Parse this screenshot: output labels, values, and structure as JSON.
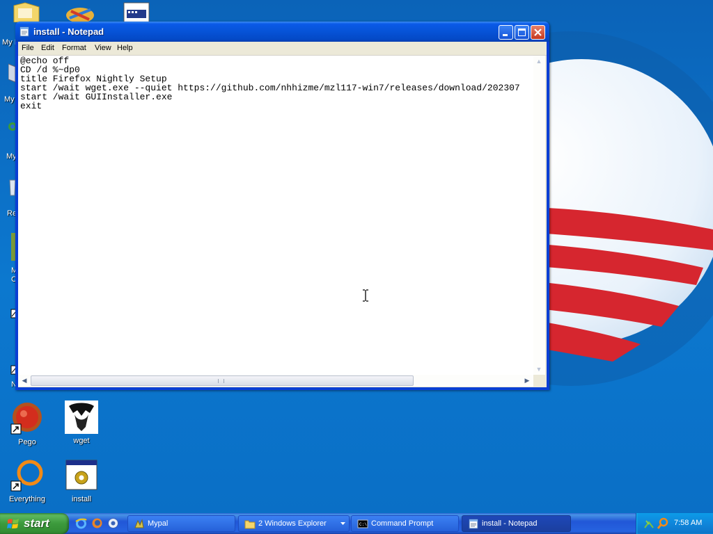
{
  "desktop": {
    "partial_labels": [
      "My I",
      "My",
      "My",
      "Re",
      "M",
      "C",
      "N"
    ],
    "icons": [
      {
        "label": "Pego",
        "icon": "pego-icon"
      },
      {
        "label": "wget",
        "icon": "wget-icon"
      },
      {
        "label": "Everything",
        "icon": "everything-icon"
      },
      {
        "label": "install",
        "icon": "batch-file-icon"
      }
    ]
  },
  "window": {
    "title": "install - Notepad",
    "menu": [
      "File",
      "Edit",
      "Format",
      "View",
      "Help"
    ],
    "content_lines": [
      "@echo off",
      "CD /d %~dp0",
      "title Firefox Nightly Setup",
      "start /wait wget.exe --quiet https://github.com/nhhizme/mzl117-win7/releases/download/202307",
      "start /wait GUIInstaller.exe",
      "exit"
    ]
  },
  "taskbar": {
    "start_label": "start",
    "quick_launch": [
      "internet-explorer-icon",
      "firefox-icon",
      "media-icon"
    ],
    "tasks": [
      {
        "label": "Mypal",
        "icon": "mypal-icon",
        "active": false
      },
      {
        "label": "2 Windows Explorer",
        "icon": "folder-icon",
        "active": false
      },
      {
        "label": "Command Prompt",
        "icon": "cmd-icon",
        "active": false
      },
      {
        "label": "install - Notepad",
        "icon": "notepad-icon",
        "active": true
      }
    ],
    "clock": "7:58 AM"
  },
  "colors": {
    "desktop_blue": "#0a6cc4",
    "titlebar_blue": "#0653d7",
    "start_green": "#3c9a3c",
    "logo_red": "#d6262f"
  }
}
